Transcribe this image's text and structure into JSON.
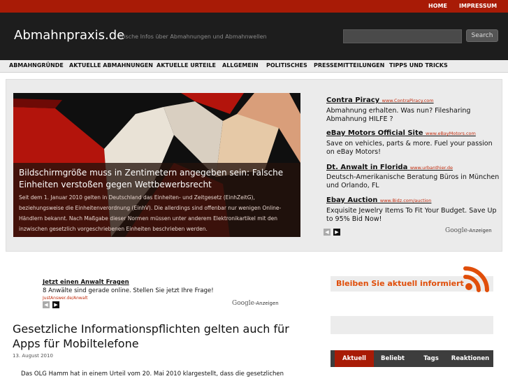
{
  "topbar": {
    "home": "HOME",
    "impressum": "IMPRESSUM"
  },
  "header": {
    "logo": "Abmahnpraxis.de",
    "tagline": "Frische Infos über Abmahnungen und Abmahnwellen",
    "search_placeholder": "",
    "search_button": "Search"
  },
  "nav": {
    "items": [
      "ABMAHNGRÜNDE",
      "AKTUELLE ABMAHNUNGEN",
      "AKTUELLE URTEILE",
      "ALLGEMEIN",
      "POLITISCHES",
      "PRESSEMITTEILUNGEN",
      "TIPPS UND TRICKS"
    ]
  },
  "featured": {
    "title": "Bildschirmgröße muss in Zentimetern angegeben sein: Falsche Einheiten verstoßen gegen Wettbewerbsrecht",
    "text": "Seit dem 1. Januar 2010 gelten in Deutschland das Einheiten- und Zeitgesetz (EinhZeitG), beziehungsweise die Einheitenverordnung (EinhV). Die allerdings sind offenbar nur wenigen Online-Händlern bekannt. Nach Maßgabe dieser Normen müssen unter anderem Elektronikartikel mit den inzwischen gesetzlich vorgeschriebenen Einheiten beschrieben werden."
  },
  "ads": [
    {
      "title": "Contra Piracy",
      "url": "www.ContraPiracy.com",
      "text": "Abmahnung erhalten. Was nun? Filesharing Abmahnung HILFE ?"
    },
    {
      "title": "eBay Motors Official Site",
      "url": "www.eBayMotors.com",
      "text": "Save on vehicles, parts & more. Fuel your passion on eBay Motors!"
    },
    {
      "title": "Dt. Anwalt in Florida",
      "url": "www.urbanthier.de",
      "text": "Deutsch-Amerikanische Beratung Büros in München und Orlando, FL"
    },
    {
      "title": "Ebay Auction",
      "url": "www.Bidz.com/auction",
      "text": "Exquisite Jewelry Items To Fit Your Budget. Save Up to 95% Bid Now!"
    }
  ],
  "google_label": "Google",
  "anzeigen_label": "-Anzeigen",
  "ad2": {
    "title": "Jetzt einen Anwalt Fragen",
    "text": "8 Anwälte sind gerade online. Stellen Sie jetzt Ihre Frage!",
    "url": "JustAnswer.de/Anwalt"
  },
  "post": {
    "title": "Gesetzliche Informationspflichten gelten auch für Apps für Mobiltelefone",
    "date": "13. August 2010",
    "body": "Das OLG Hamm hat in einem Urteil vom 20. Mai 2010 klargestellt, dass die gesetzlichen"
  },
  "sidebar": {
    "subscribe": "Bleiben Sie aktuell informiert",
    "tabs": [
      "Aktuell",
      "Beliebt",
      "Tags",
      "Reaktionen"
    ]
  },
  "colors": {
    "accent": "#a81b06",
    "header_bg": "#1d1d1d",
    "rss_orange": "#e04e0a"
  }
}
